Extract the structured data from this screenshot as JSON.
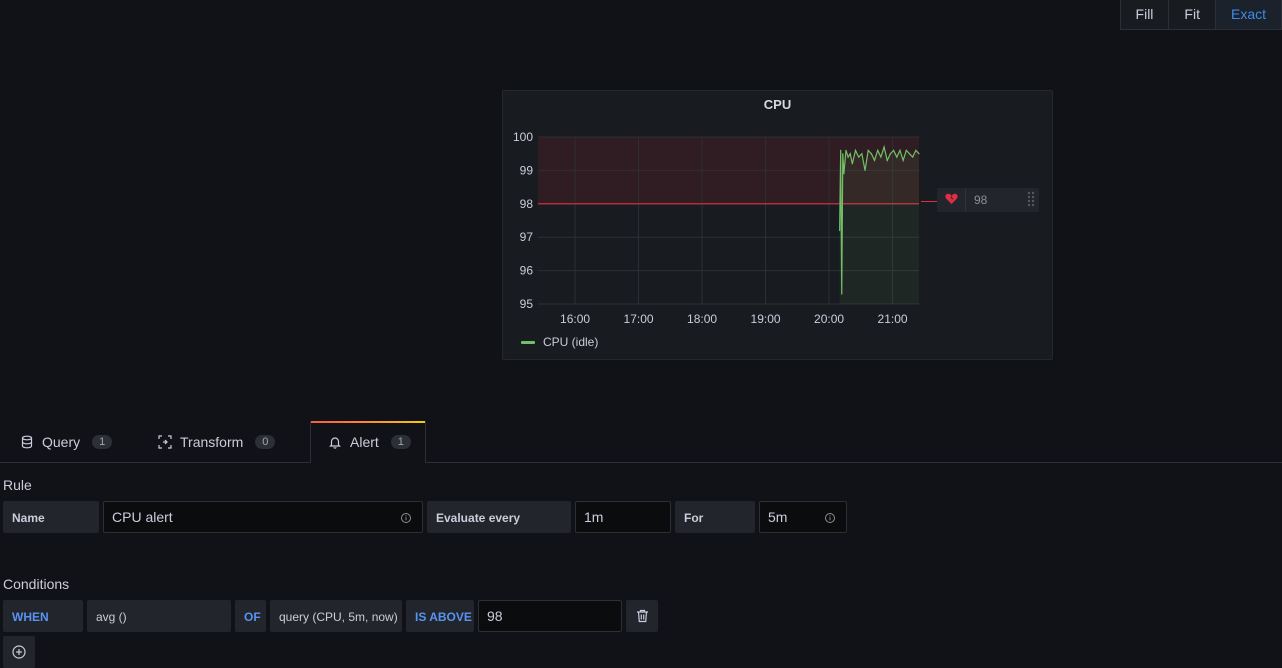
{
  "view_modes": [
    {
      "label": "Fill",
      "active": false
    },
    {
      "label": "Fit",
      "active": false
    },
    {
      "label": "Exact",
      "active": true
    }
  ],
  "panel": {
    "title": "CPU",
    "threshold_handle": {
      "value": "98"
    },
    "legend": {
      "series_name": "CPU (idle)",
      "color": "#73bf69"
    }
  },
  "chart_data": {
    "type": "line",
    "title": "CPU",
    "xlabel": "",
    "ylabel": "",
    "ylim": [
      95,
      100
    ],
    "xlim": [
      "15:25",
      "21:25"
    ],
    "x_ticks": [
      "16:00",
      "17:00",
      "18:00",
      "19:00",
      "20:00",
      "21:00"
    ],
    "y_ticks": [
      95,
      96,
      97,
      98,
      99,
      100
    ],
    "threshold": {
      "value": 98,
      "op": "gt",
      "color": "#e02f44"
    },
    "grid": true,
    "legend_position": "bottom-left",
    "series": [
      {
        "name": "CPU (idle)",
        "color": "#73bf69",
        "x": [
          "20:10",
          "20:11",
          "20:12",
          "20:13",
          "20:14",
          "20:16",
          "20:18",
          "20:20",
          "20:22",
          "20:25",
          "20:28",
          "20:31",
          "20:34",
          "20:37",
          "20:40",
          "20:43",
          "20:46",
          "20:49",
          "20:52",
          "20:55",
          "20:58",
          "21:01",
          "21:04",
          "21:07",
          "21:10",
          "21:13",
          "21:16",
          "21:19",
          "21:22",
          "21:25"
        ],
        "values": [
          97.2,
          99.6,
          95.3,
          99.5,
          98.9,
          99.6,
          99.4,
          99.5,
          99.2,
          99.6,
          99.4,
          99.5,
          99.0,
          99.6,
          99.5,
          99.3,
          99.6,
          99.4,
          99.7,
          99.3,
          99.5,
          99.6,
          99.4,
          99.6,
          99.3,
          99.6,
          99.5,
          99.4,
          99.6,
          99.5
        ]
      }
    ]
  },
  "tabs": [
    {
      "label": "Query",
      "count": "1"
    },
    {
      "label": "Transform",
      "count": "0"
    },
    {
      "label": "Alert",
      "count": "1",
      "active": true
    }
  ],
  "rule": {
    "heading": "Rule",
    "name_label": "Name",
    "name_value": "CPU alert",
    "evaluate_label": "Evaluate every",
    "evaluate_value": "1m",
    "for_label": "For",
    "for_value": "5m"
  },
  "conditions": {
    "heading": "Conditions",
    "when": "WHEN",
    "reducer": "avg ()",
    "of": "OF",
    "query": "query (CPU, 5m, now)",
    "evaluator": "IS ABOVE",
    "threshold_value": "98"
  },
  "colors": {
    "accent": "#3d8ae6",
    "threshold": "#e02f44",
    "series": "#73bf69"
  }
}
